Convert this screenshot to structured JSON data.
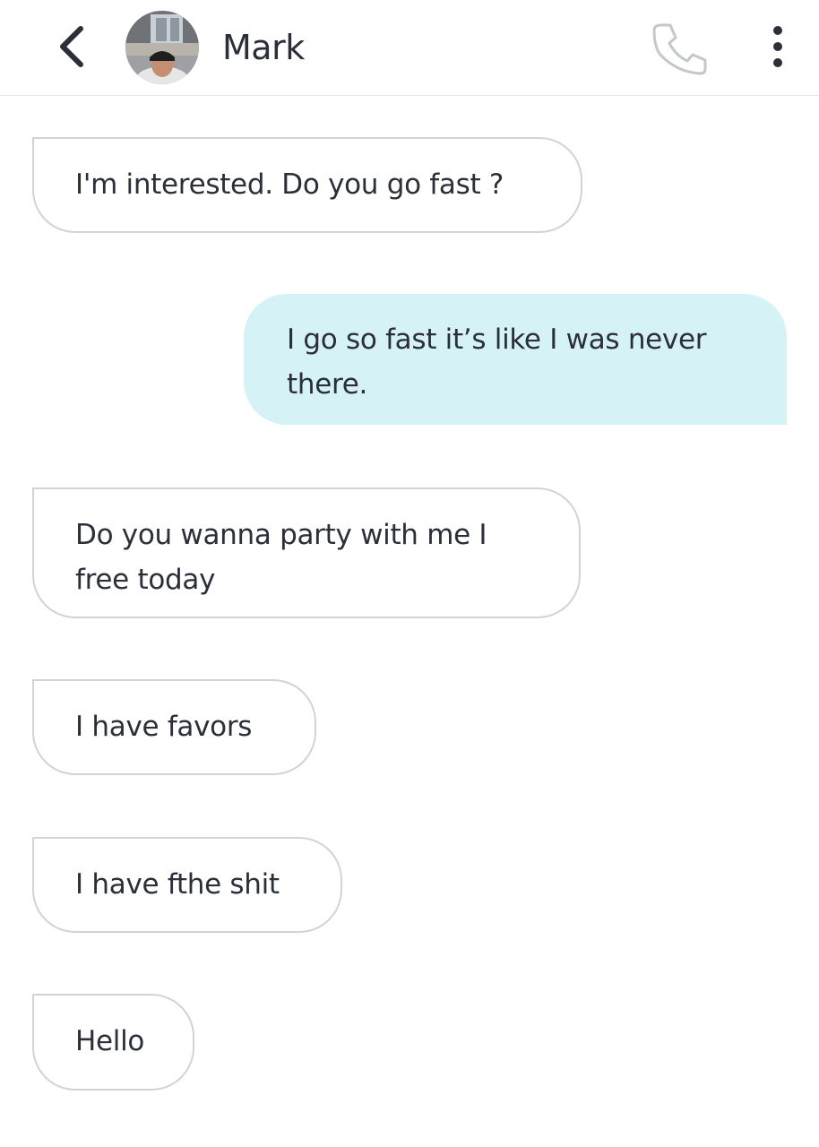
{
  "header": {
    "contact_name": "Mark",
    "back_icon": "chevron-left-icon",
    "call_icon": "phone-icon",
    "more_icon": "more-vertical-icon"
  },
  "colors": {
    "outgoing_bubble": "#d5f3f7",
    "incoming_border": "#d3d3d3",
    "text": "#2b2f3a"
  },
  "messages": [
    {
      "direction": "incoming",
      "text": "I'm interested. Do you go fast ?"
    },
    {
      "direction": "outgoing",
      "text": "I go so fast it’s like I was never there."
    },
    {
      "direction": "incoming",
      "text": "Do you wanna party with me I free today"
    },
    {
      "direction": "incoming",
      "text": "I have favors"
    },
    {
      "direction": "incoming",
      "text": "I have fthe shit"
    },
    {
      "direction": "incoming",
      "text": "Hello"
    }
  ]
}
